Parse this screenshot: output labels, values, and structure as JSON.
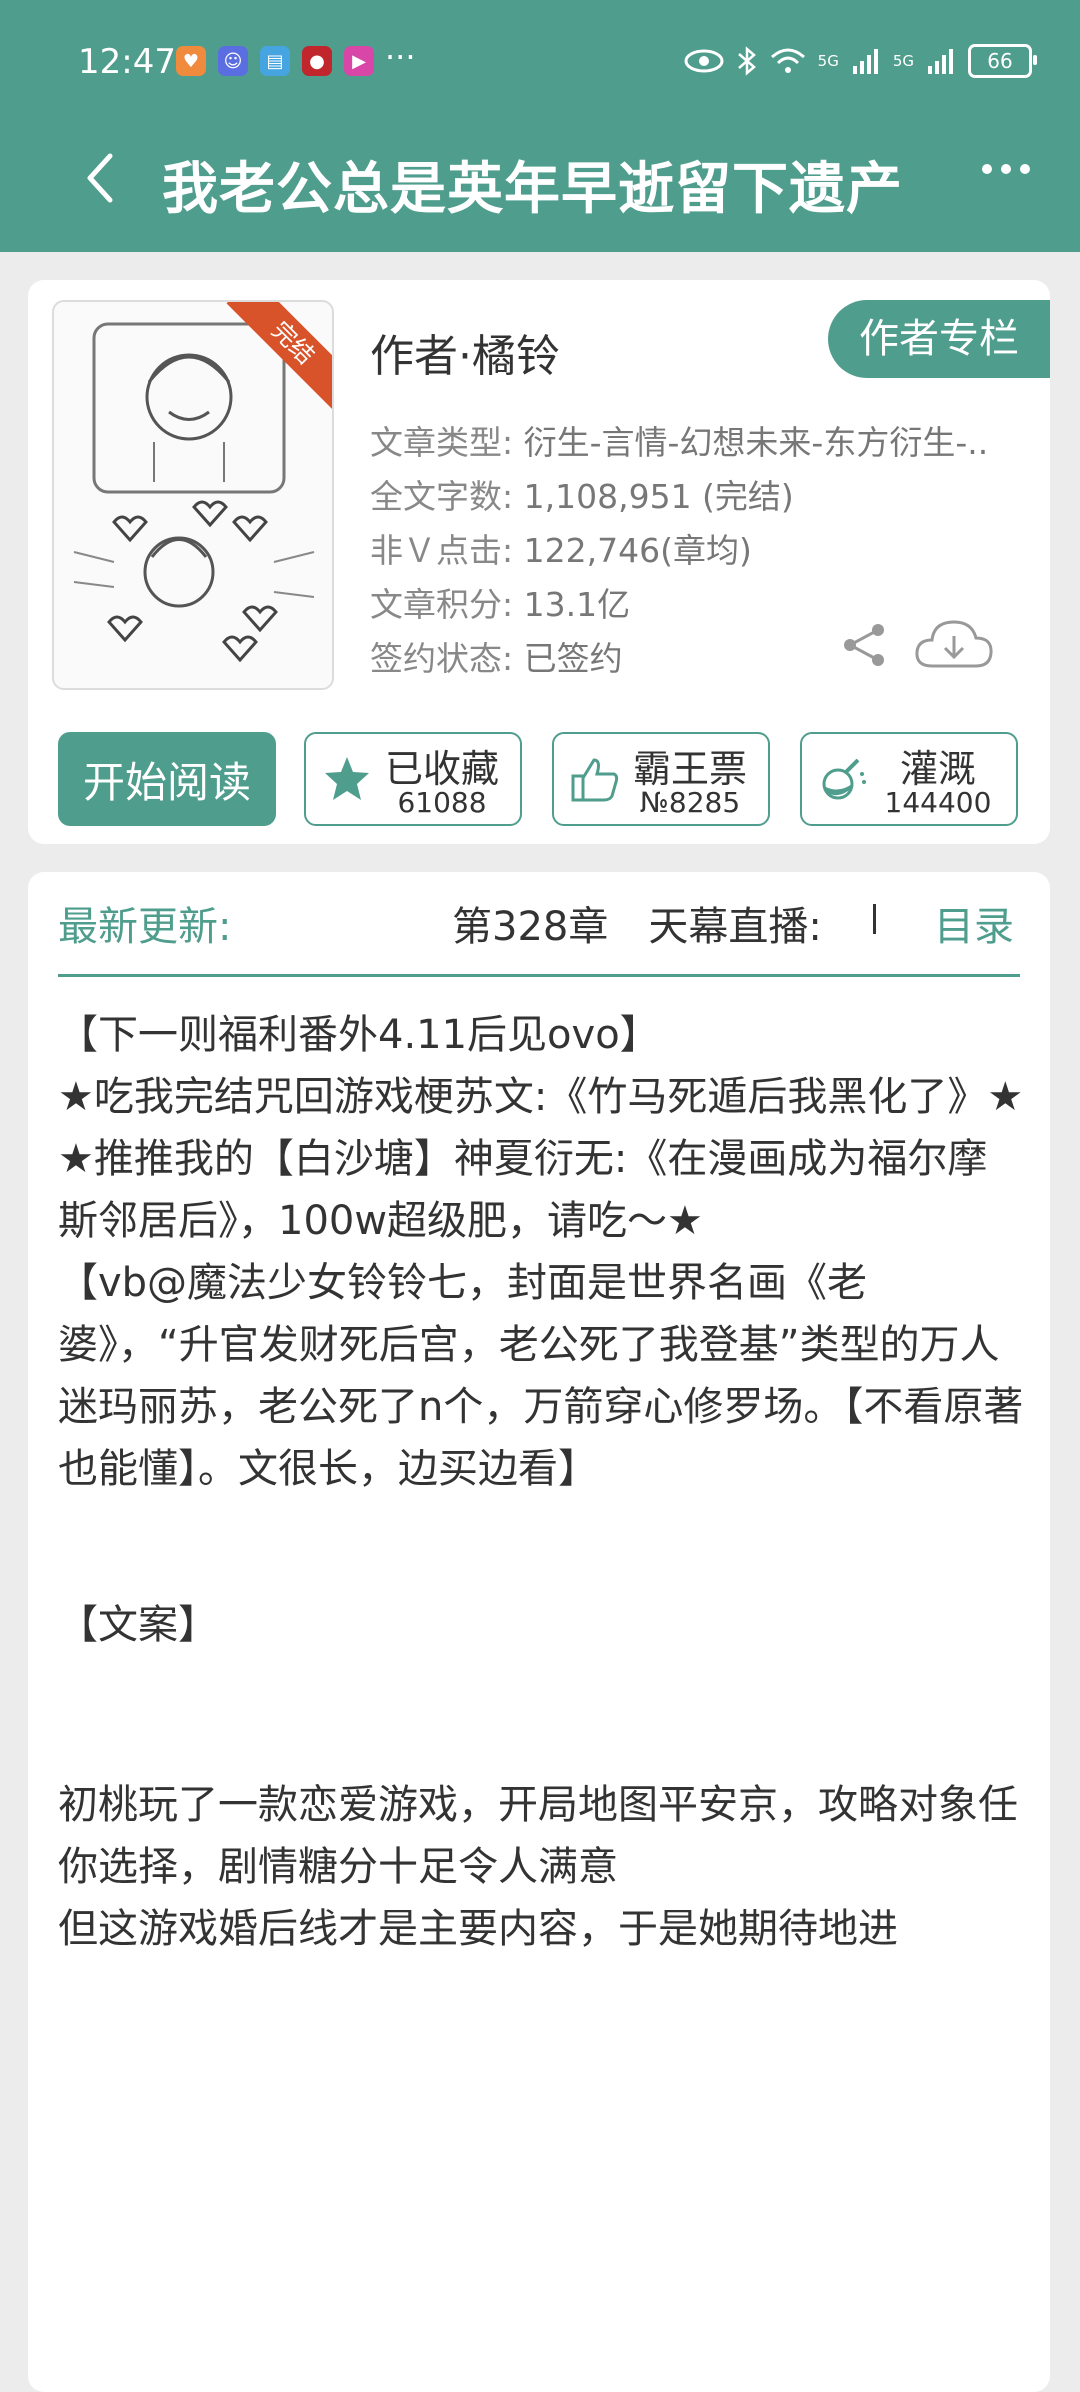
{
  "status_bar": {
    "time": "12:47",
    "more": "···",
    "network1": "5G",
    "network2": "5G",
    "battery": "66"
  },
  "nav": {
    "title": "我老公总是英年早逝留下遗产"
  },
  "book": {
    "ribbon": "完结",
    "author": "作者·橘铃",
    "author_column_label": "作者专栏",
    "meta": [
      {
        "key": "文章类型: ",
        "value": "衍生-言情-幻想未来-东方衍生-.."
      },
      {
        "key": "全文字数: ",
        "value": "1,108,951 (完结)"
      },
      {
        "key": "非Ｖ点击: ",
        "value": "122,746(章均)"
      },
      {
        "key": "文章积分: ",
        "value": "13.1亿"
      },
      {
        "key": "签约状态: ",
        "value": "已签约"
      }
    ],
    "read_button": "开始阅读",
    "actions": [
      {
        "label": "已收藏",
        "count": "61088"
      },
      {
        "label": "霸王票",
        "count": "№8285"
      },
      {
        "label": "灌溉",
        "count": "144400"
      }
    ]
  },
  "latest": {
    "label": "最新更新:",
    "chapter": "第328章　天幕直播:",
    "toc": "目录"
  },
  "description": {
    "p1": "【下一则福利番外4.11后见ovo】",
    "p2": "★吃我完结咒回游戏梗苏文:《竹马死遁后我黑化了》★",
    "p3": "★推推我的【白沙塘】神夏衍无:《在漫画成为福尔摩斯邻居后》，100w超级肥，请吃～★",
    "p4": "【vb@魔法少女铃铃七，封面是世界名画《老婆》，“升官发财死后宫，老公死了我登基”类型的万人迷玛丽苏，老公死了n个，万箭穿心修罗场。【不看原著也能懂】。文很长，边买边看】",
    "p5": "【文案】",
    "p6": "初桃玩了一款恋爱游戏，开局地图平安京，攻略对象任你选择，剧情糖分十足令人满意",
    "p7": "但这游戏婚后线才是主要内容，于是她期待地进"
  },
  "colors": {
    "brand": "#4f9d8d",
    "ribbon": "#d9532a"
  }
}
